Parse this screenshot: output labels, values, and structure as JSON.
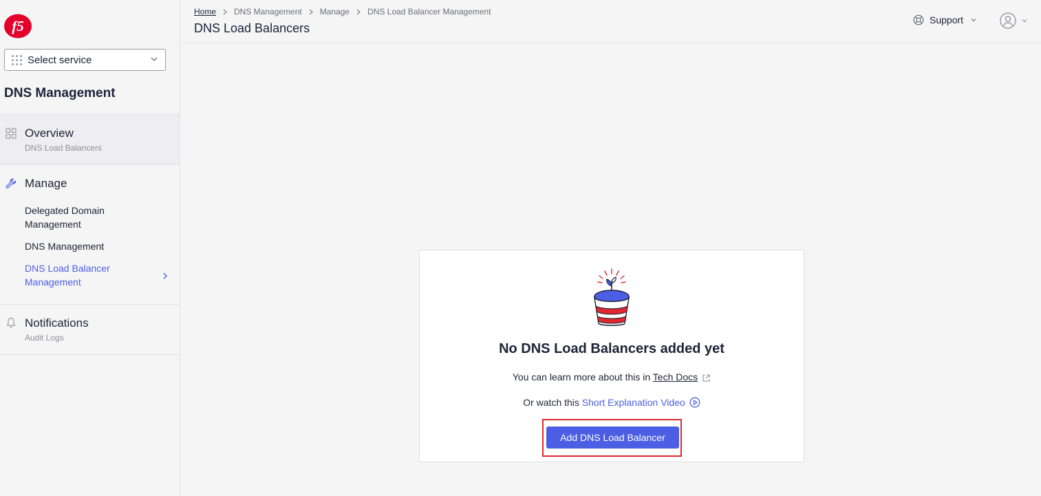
{
  "brand": {
    "logo_text": "f5",
    "accent": "#4b5ee4",
    "logo_color": "#e4002b"
  },
  "sidebar": {
    "service_select": {
      "label": "Select service",
      "icon": "grid-dots-icon"
    },
    "title": "DNS Management",
    "sections": {
      "overview": {
        "label": "Overview",
        "sub": "DNS Load Balancers",
        "icon": "grid-icon"
      },
      "manage": {
        "label": "Manage",
        "icon": "wrench-icon",
        "items": [
          {
            "label": "Delegated Domain Management",
            "active": false
          },
          {
            "label": "DNS Management",
            "active": false
          },
          {
            "label": "DNS Load Balancer Management",
            "active": true
          }
        ]
      },
      "notifications": {
        "label": "Notifications",
        "sub": "Audit Logs",
        "icon": "bell-icon"
      }
    }
  },
  "header": {
    "breadcrumb": [
      "Home",
      "DNS Management",
      "Manage",
      "DNS Load Balancer Management"
    ],
    "title": "DNS Load Balancers",
    "support_label": "Support"
  },
  "empty_state": {
    "title": "No DNS Load Balancers added yet",
    "learn_prefix": "You can learn more about this in",
    "learn_link": "Tech Docs",
    "watch_prefix": "Or watch this",
    "watch_link": "Short Explanation Video",
    "button_label": "Add DNS Load Balancer",
    "illustration": "plant-pot-icon"
  }
}
